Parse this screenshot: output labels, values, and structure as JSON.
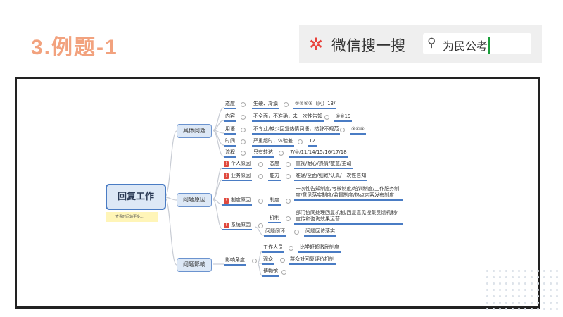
{
  "title": "3.例题-1",
  "search": {
    "icon": "wechat-search-icon",
    "brand": "微信搜一搜",
    "query": "为民公考"
  },
  "mindmap": {
    "root": "回复工作",
    "note": "查看时间轴更多...",
    "branches": [
      "具体问题",
      "问题原因",
      "问题影响"
    ],
    "issues": [
      [
        "态度",
        "生硬、冷漠",
        "①②⑤⑨（问）13/"
      ],
      [
        "内容",
        "不全面，不准确，未一次性告知",
        "⑥⑧19"
      ],
      [
        "用语",
        "不专业/缺少回复热情问语，措辞不规范",
        "③④⑧"
      ],
      [
        "时间",
        "严重超时，体验差",
        "12"
      ],
      [
        "流程",
        "只有转达",
        "7/⑩/11/14/15/16/17/18"
      ]
    ],
    "reasons": [
      [
        "个人原因",
        "态度",
        "重视/耐心/热情/敬意/主动"
      ],
      [
        "业务原因",
        "能力",
        "准确/全面/细致/认真/一次性告知"
      ],
      [
        "制度原因",
        "制度",
        "一次性告知制度/考核制度/培训制度/工作服务制度/意见落实制度/监督制度/热点内容发布制度"
      ],
      [
        "系统原因",
        "机制",
        "部门协同处理回复机制/回复意见搜集反馈机制/宣传和咨询效果运营"
      ]
    ],
    "closure": [
      "问题闭环",
      "问题回访落实"
    ],
    "badge": "!",
    "impact": {
      "label": "影响角度",
      "items": [
        [
          "工作人员",
          "比学赶超激励制度"
        ],
        [
          "观众",
          "群众对回复评价机制"
        ],
        [
          "博物馆",
          ""
        ]
      ]
    }
  }
}
